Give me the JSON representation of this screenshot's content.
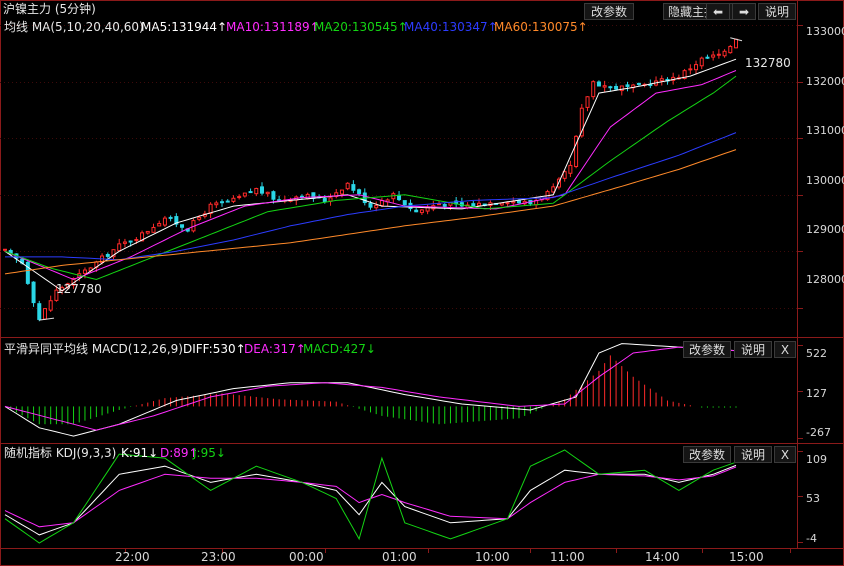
{
  "panel1": {
    "title": "沪镍主力 (5分钟)",
    "ma_header": "均线 MA(5,10,20,40,60)",
    "ma5": "MA5:131944↑",
    "ma10": "MA10:131189↑",
    "ma20": "MA20:130545↑",
    "ma40": "MA40:130347↑",
    "ma60": "MA60:130075↑",
    "buttons": {
      "params": "改参数",
      "hide": "隐藏主指标",
      "left": "⬅",
      "right": "➡",
      "help": "说明"
    },
    "high_label": "132780",
    "low_label": "127780",
    "yticks": [
      "133000",
      "132000",
      "131000",
      "130000",
      "129000",
      "128000"
    ]
  },
  "panel2": {
    "title": "平滑异同平均线 MACD(12,26,9)",
    "diff": "DIFF:530↑",
    "dea": "DEA:317↑",
    "macd": "MACD:427↓",
    "buttons": {
      "params": "改参数",
      "help": "说明",
      "close": "X"
    },
    "yticks": [
      "522",
      "127",
      "-267"
    ]
  },
  "panel3": {
    "title": "随机指标 KDJ(9,3,3)",
    "k": "K:91↓",
    "d": "D:89↑",
    "j": "J:95↓",
    "buttons": {
      "params": "改参数",
      "help": "说明",
      "close": "X"
    },
    "yticks": [
      "109",
      "53",
      "-4"
    ]
  },
  "xticks": [
    "22:00",
    "23:00",
    "00:00",
    "01:00",
    "10:00",
    "11:00",
    "14:00",
    "15:00"
  ],
  "colors": {
    "up": "#ff2a2a",
    "down": "#2ad6e6",
    "ma5": "#ffffff",
    "ma10": "#ff2cff",
    "ma20": "#14d414",
    "ma40": "#2c3cff",
    "ma60": "#ff8a2a",
    "grid": "#8b1a1a"
  },
  "chart_data": [
    {
      "type": "candlestick",
      "title": "沪镍主力 (5分钟)",
      "ylim": [
        127500,
        133200
      ],
      "x_session_ticks": [
        "22:00",
        "23:00",
        "00:00",
        "01:00",
        "10:00",
        "11:00",
        "14:00",
        "15:00"
      ],
      "close_keypoints": [
        [
          0,
          129000
        ],
        [
          3,
          128800
        ],
        [
          6,
          127800
        ],
        [
          9,
          128300
        ],
        [
          12,
          128500
        ],
        [
          16,
          128800
        ],
        [
          20,
          129100
        ],
        [
          24,
          129300
        ],
        [
          28,
          129600
        ],
        [
          32,
          129400
        ],
        [
          36,
          129800
        ],
        [
          40,
          129900
        ],
        [
          44,
          130100
        ],
        [
          48,
          129900
        ],
        [
          52,
          130000
        ],
        [
          56,
          129900
        ],
        [
          60,
          130200
        ],
        [
          64,
          129800
        ],
        [
          68,
          130000
        ],
        [
          72,
          129700
        ],
        [
          76,
          129850
        ],
        [
          80,
          129800
        ],
        [
          84,
          129850
        ],
        [
          88,
          129900
        ],
        [
          92,
          129850
        ],
        [
          96,
          130100
        ],
        [
          99,
          130500
        ],
        [
          101,
          131500
        ],
        [
          103,
          132000
        ],
        [
          106,
          131900
        ],
        [
          110,
          131900
        ],
        [
          114,
          132000
        ],
        [
          118,
          132100
        ],
        [
          122,
          132400
        ],
        [
          126,
          132500
        ],
        [
          128,
          132780
        ]
      ],
      "series": [
        {
          "name": "MA5",
          "keypoints": [
            [
              0,
              129000
            ],
            [
              10,
              128300
            ],
            [
              20,
              129000
            ],
            [
              30,
              129500
            ],
            [
              40,
              129800
            ],
            [
              50,
              129900
            ],
            [
              60,
              130000
            ],
            [
              66,
              129800
            ],
            [
              80,
              129750
            ],
            [
              96,
              130000
            ],
            [
              104,
              131800
            ],
            [
              110,
              131900
            ],
            [
              120,
              132100
            ],
            [
              128,
              132400
            ]
          ]
        },
        {
          "name": "MA10",
          "keypoints": [
            [
              0,
              129000
            ],
            [
              12,
              128500
            ],
            [
              22,
              128900
            ],
            [
              32,
              129400
            ],
            [
              42,
              129800
            ],
            [
              52,
              129950
            ],
            [
              62,
              130000
            ],
            [
              70,
              129800
            ],
            [
              86,
              129750
            ],
            [
              98,
              130000
            ],
            [
              106,
              131200
            ],
            [
              114,
              131800
            ],
            [
              122,
              131950
            ],
            [
              128,
              132200
            ]
          ]
        },
        {
          "name": "MA20",
          "keypoints": [
            [
              0,
              129000
            ],
            [
              8,
              128700
            ],
            [
              16,
              128500
            ],
            [
              26,
              128900
            ],
            [
              36,
              129300
            ],
            [
              46,
              129700
            ],
            [
              58,
              129900
            ],
            [
              70,
              130000
            ],
            [
              84,
              129750
            ],
            [
              96,
              129850
            ],
            [
              106,
              130600
            ],
            [
              116,
              131300
            ],
            [
              124,
              131800
            ],
            [
              128,
              132100
            ]
          ]
        },
        {
          "name": "MA40",
          "keypoints": [
            [
              0,
              128900
            ],
            [
              10,
              128900
            ],
            [
              20,
              128850
            ],
            [
              30,
              129000
            ],
            [
              40,
              129200
            ],
            [
              50,
              129450
            ],
            [
              60,
              129650
            ],
            [
              70,
              129800
            ],
            [
              82,
              129900
            ],
            [
              96,
              129950
            ],
            [
              106,
              130300
            ],
            [
              118,
              130700
            ],
            [
              128,
              131100
            ]
          ]
        },
        {
          "name": "MA60",
          "keypoints": [
            [
              0,
              128600
            ],
            [
              10,
              128750
            ],
            [
              20,
              128850
            ],
            [
              30,
              128950
            ],
            [
              40,
              129050
            ],
            [
              50,
              129150
            ],
            [
              60,
              129300
            ],
            [
              70,
              129450
            ],
            [
              82,
              129600
            ],
            [
              96,
              129800
            ],
            [
              108,
              130150
            ],
            [
              118,
              130450
            ],
            [
              128,
              130800
            ]
          ]
        }
      ],
      "annotations": [
        "132780",
        "127780"
      ]
    },
    {
      "type": "line",
      "title": "平滑异同平均线 MACD(12,26,9)",
      "ylim": [
        -300,
        560
      ],
      "series": [
        {
          "name": "DIFF",
          "keypoints": [
            [
              0,
              0
            ],
            [
              6,
              -180
            ],
            [
              12,
              -250
            ],
            [
              20,
              -150
            ],
            [
              30,
              50
            ],
            [
              40,
              150
            ],
            [
              50,
              200
            ],
            [
              60,
              200
            ],
            [
              70,
              100
            ],
            [
              80,
              20
            ],
            [
              92,
              -30
            ],
            [
              100,
              80
            ],
            [
              104,
              450
            ],
            [
              108,
              530
            ],
            [
              118,
              500
            ],
            [
              128,
              470
            ]
          ]
        },
        {
          "name": "DEA",
          "keypoints": [
            [
              0,
              0
            ],
            [
              8,
              -100
            ],
            [
              16,
              -200
            ],
            [
              26,
              -80
            ],
            [
              36,
              80
            ],
            [
              46,
              170
            ],
            [
              56,
              200
            ],
            [
              66,
              160
            ],
            [
              76,
              80
            ],
            [
              90,
              0
            ],
            [
              98,
              20
            ],
            [
              104,
              250
            ],
            [
              110,
              450
            ],
            [
              118,
              500
            ],
            [
              128,
              470
            ]
          ]
        },
        {
          "name": "MACD",
          "keypoints": [
            [
              0,
              0
            ],
            [
              6,
              -150
            ],
            [
              12,
              -150
            ],
            [
              20,
              -30
            ],
            [
              28,
              70
            ],
            [
              38,
              110
            ],
            [
              48,
              60
            ],
            [
              58,
              40
            ],
            [
              66,
              -80
            ],
            [
              76,
              -150
            ],
            [
              90,
              -100
            ],
            [
              98,
              60
            ],
            [
              104,
              300
            ],
            [
              106,
              430
            ],
            [
              110,
              250
            ],
            [
              116,
              50
            ],
            [
              122,
              -10
            ],
            [
              128,
              -10
            ]
          ]
        }
      ]
    },
    {
      "type": "line",
      "title": "随机指标 KDJ(9,3,3)",
      "ylim": [
        -10,
        115
      ],
      "series": [
        {
          "name": "K",
          "keypoints": [
            [
              0,
              30
            ],
            [
              6,
              5
            ],
            [
              12,
              20
            ],
            [
              20,
              80
            ],
            [
              28,
              90
            ],
            [
              36,
              70
            ],
            [
              44,
              80
            ],
            [
              52,
              70
            ],
            [
              58,
              60
            ],
            [
              62,
              30
            ],
            [
              66,
              70
            ],
            [
              70,
              40
            ],
            [
              78,
              20
            ],
            [
              88,
              25
            ],
            [
              92,
              60
            ],
            [
              98,
              85
            ],
            [
              104,
              80
            ],
            [
              112,
              80
            ],
            [
              118,
              70
            ],
            [
              124,
              80
            ],
            [
              128,
              91
            ]
          ]
        },
        {
          "name": "D",
          "keypoints": [
            [
              0,
              35
            ],
            [
              6,
              15
            ],
            [
              12,
              20
            ],
            [
              20,
              60
            ],
            [
              28,
              80
            ],
            [
              36,
              75
            ],
            [
              44,
              75
            ],
            [
              52,
              70
            ],
            [
              58,
              65
            ],
            [
              62,
              45
            ],
            [
              66,
              55
            ],
            [
              70,
              45
            ],
            [
              78,
              28
            ],
            [
              88,
              25
            ],
            [
              92,
              45
            ],
            [
              98,
              70
            ],
            [
              104,
              80
            ],
            [
              112,
              78
            ],
            [
              118,
              73
            ],
            [
              124,
              78
            ],
            [
              128,
              89
            ]
          ]
        },
        {
          "name": "J",
          "keypoints": [
            [
              0,
              25
            ],
            [
              6,
              -5
            ],
            [
              12,
              20
            ],
            [
              20,
              105
            ],
            [
              28,
              100
            ],
            [
              36,
              60
            ],
            [
              44,
              90
            ],
            [
              52,
              70
            ],
            [
              58,
              50
            ],
            [
              62,
              0
            ],
            [
              66,
              100
            ],
            [
              70,
              20
            ],
            [
              78,
              0
            ],
            [
              88,
              25
            ],
            [
              92,
              90
            ],
            [
              98,
              110
            ],
            [
              104,
              80
            ],
            [
              112,
              85
            ],
            [
              118,
              60
            ],
            [
              124,
              85
            ],
            [
              128,
              95
            ]
          ]
        }
      ]
    }
  ]
}
